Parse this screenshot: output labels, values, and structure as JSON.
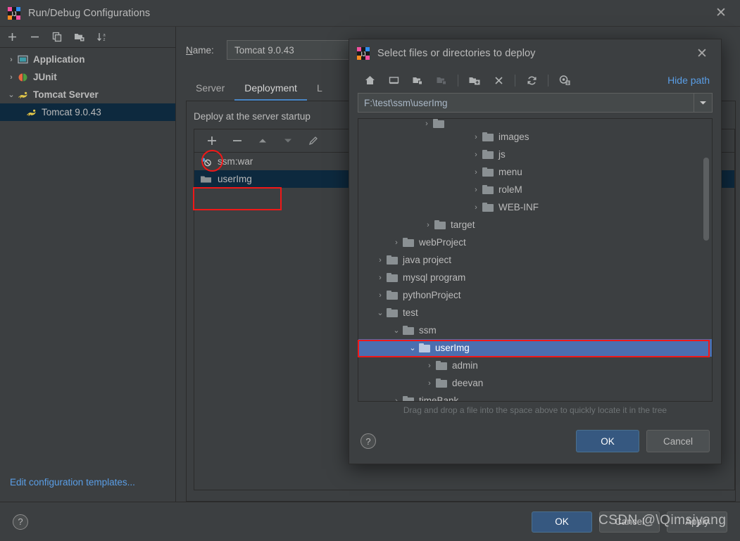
{
  "main_window": {
    "title": "Run/Debug Configurations",
    "icon": "intellij-idea-icon",
    "close_label": "✕",
    "toolbar": {
      "add": "+",
      "remove": "−",
      "copy": "copy-icon",
      "new_folder": "new-folder-icon",
      "sort": "sort-alphabetically-icon"
    },
    "config_tree": [
      {
        "label": "Application",
        "arrow": "›",
        "icon": "application-icon",
        "indent": 0,
        "bold": true,
        "selected": false
      },
      {
        "label": "JUnit",
        "arrow": "›",
        "icon": "junit-icon",
        "indent": 0,
        "bold": true,
        "selected": false
      },
      {
        "label": "Tomcat Server",
        "arrow": "⌄",
        "icon": "tomcat-icon",
        "indent": 0,
        "bold": true,
        "selected": false
      },
      {
        "label": "Tomcat 9.0.43",
        "arrow": "",
        "icon": "tomcat-icon",
        "indent": 1,
        "bold": false,
        "selected": true
      }
    ],
    "edit_templates_link": "Edit configuration templates...",
    "name_label": "Name:",
    "name_value": "Tomcat 9.0.43",
    "tabs": [
      {
        "label": "Server",
        "active": false
      },
      {
        "label": "Deployment",
        "active": true
      },
      {
        "label": "L",
        "active": false
      }
    ],
    "deployment": {
      "section_label": "Deploy at the server startup",
      "toolbar": {
        "add": "+",
        "remove": "−",
        "move_up": "▲",
        "move_down": "▼",
        "edit": "pencil-icon"
      },
      "items": [
        {
          "label": "ssm:war",
          "icon": "artifact-icon",
          "selected": false
        },
        {
          "label": "userImg",
          "icon": "folder-icon",
          "selected": true
        }
      ]
    },
    "footer": {
      "help": "?",
      "ok": "OK",
      "cancel": "Cancel",
      "apply": "Apply"
    }
  },
  "file_dialog": {
    "title": "Select files or directories to deploy",
    "icon": "intellij-idea-icon",
    "close_label": "✕",
    "toolbar": [
      {
        "name": "home-icon",
        "disabled": false
      },
      {
        "name": "desktop-icon",
        "disabled": false
      },
      {
        "name": "project-folder-icon",
        "disabled": false
      },
      {
        "name": "module-folder-icon",
        "disabled": true
      },
      {
        "name": "new-folder-icon",
        "disabled": false
      },
      {
        "name": "delete-icon",
        "disabled": false
      },
      {
        "name": "refresh-icon",
        "disabled": false
      },
      {
        "name": "show-hidden-files-icon",
        "disabled": false
      }
    ],
    "hide_path_label": "Hide path",
    "path_value": "F:\\test\\ssm\\userImg",
    "tree": [
      {
        "label": "",
        "indent": 4,
        "arrow": "›",
        "selected": false,
        "clipped": true
      },
      {
        "label": "images",
        "indent": 4,
        "arrow": "›",
        "selected": false
      },
      {
        "label": "js",
        "indent": 4,
        "arrow": "›",
        "selected": false
      },
      {
        "label": "menu",
        "indent": 4,
        "arrow": "›",
        "selected": false
      },
      {
        "label": "roleM",
        "indent": 4,
        "arrow": "›",
        "selected": false
      },
      {
        "label": "WEB-INF",
        "indent": 4,
        "arrow": "›",
        "selected": false
      },
      {
        "label": "target",
        "indent": 3,
        "arrow": "›",
        "selected": false
      },
      {
        "label": "webProject",
        "indent": 2,
        "arrow": "›",
        "selected": false
      },
      {
        "label": "java project",
        "indent": 1,
        "arrow": "›",
        "selected": false
      },
      {
        "label": "mysql program",
        "indent": 1,
        "arrow": "›",
        "selected": false
      },
      {
        "label": "pythonProject",
        "indent": 1,
        "arrow": "›",
        "selected": false
      },
      {
        "label": "test",
        "indent": 1,
        "arrow": "⌄",
        "selected": false
      },
      {
        "label": "ssm",
        "indent": 2,
        "arrow": "⌄",
        "selected": false
      },
      {
        "label": "userImg",
        "indent": 3,
        "arrow": "⌄",
        "selected": true
      },
      {
        "label": "admin",
        "indent": 4,
        "arrow": "›",
        "selected": false
      },
      {
        "label": "deevan",
        "indent": 4,
        "arrow": "›",
        "selected": false
      },
      {
        "label": "timeBank",
        "indent": 2,
        "arrow": "›",
        "selected": false
      }
    ],
    "hint": "Drag and drop a file into the space above to quickly locate it in the tree",
    "footer": {
      "help": "?",
      "ok": "OK",
      "cancel": "Cancel"
    }
  },
  "watermark": "CSDN @\\Qimsiyang",
  "colors": {
    "window_bg": "#3c3f41",
    "selection_blue": "#4b6eaf",
    "tree_selection_dark": "#0d293e",
    "accent_link": "#5a9ee6",
    "primary_button": "#365880",
    "annotation_red": "#f01818",
    "tab_underline": "#4a88c7"
  }
}
